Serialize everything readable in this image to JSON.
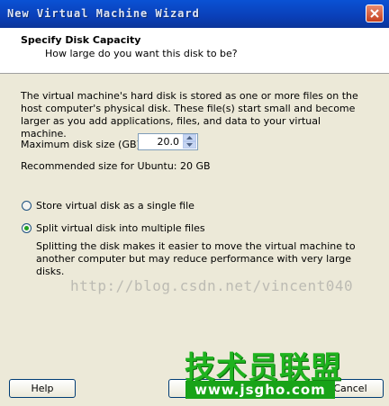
{
  "window": {
    "title": "New Virtual Machine Wizard"
  },
  "header": {
    "title": "Specify Disk Capacity",
    "subtitle": "How large do you want this disk to be?"
  },
  "content": {
    "description": "The virtual machine's hard disk is stored as one or more files on the host computer's physical disk. These file(s) start small and become larger as you add applications, files, and data to your virtual machine.",
    "max_disk_size_label": "Maximum disk size (GB):",
    "max_disk_size_value": "20.0",
    "recommended_size": "Recommended size for Ubuntu: 20 GB",
    "options": [
      {
        "label": "Store virtual disk as a single file",
        "selected": false
      },
      {
        "label": "Split virtual disk into multiple files",
        "selected": true
      }
    ],
    "split_description": "Splitting the disk makes it easier to move the virtual machine to another computer but may reduce performance with very large disks."
  },
  "buttons": {
    "help": "Help",
    "back": "",
    "cancel": "Cancel"
  },
  "watermark": {
    "url_text": "http://blog.csdn.net/vincent040",
    "logo_text": "技术员联盟",
    "logo_url": "www.jsgho.com"
  },
  "colors": {
    "titlebar": "#0a52d4",
    "radio_selected": "#21a121",
    "logo_green": "#1fb31f"
  }
}
